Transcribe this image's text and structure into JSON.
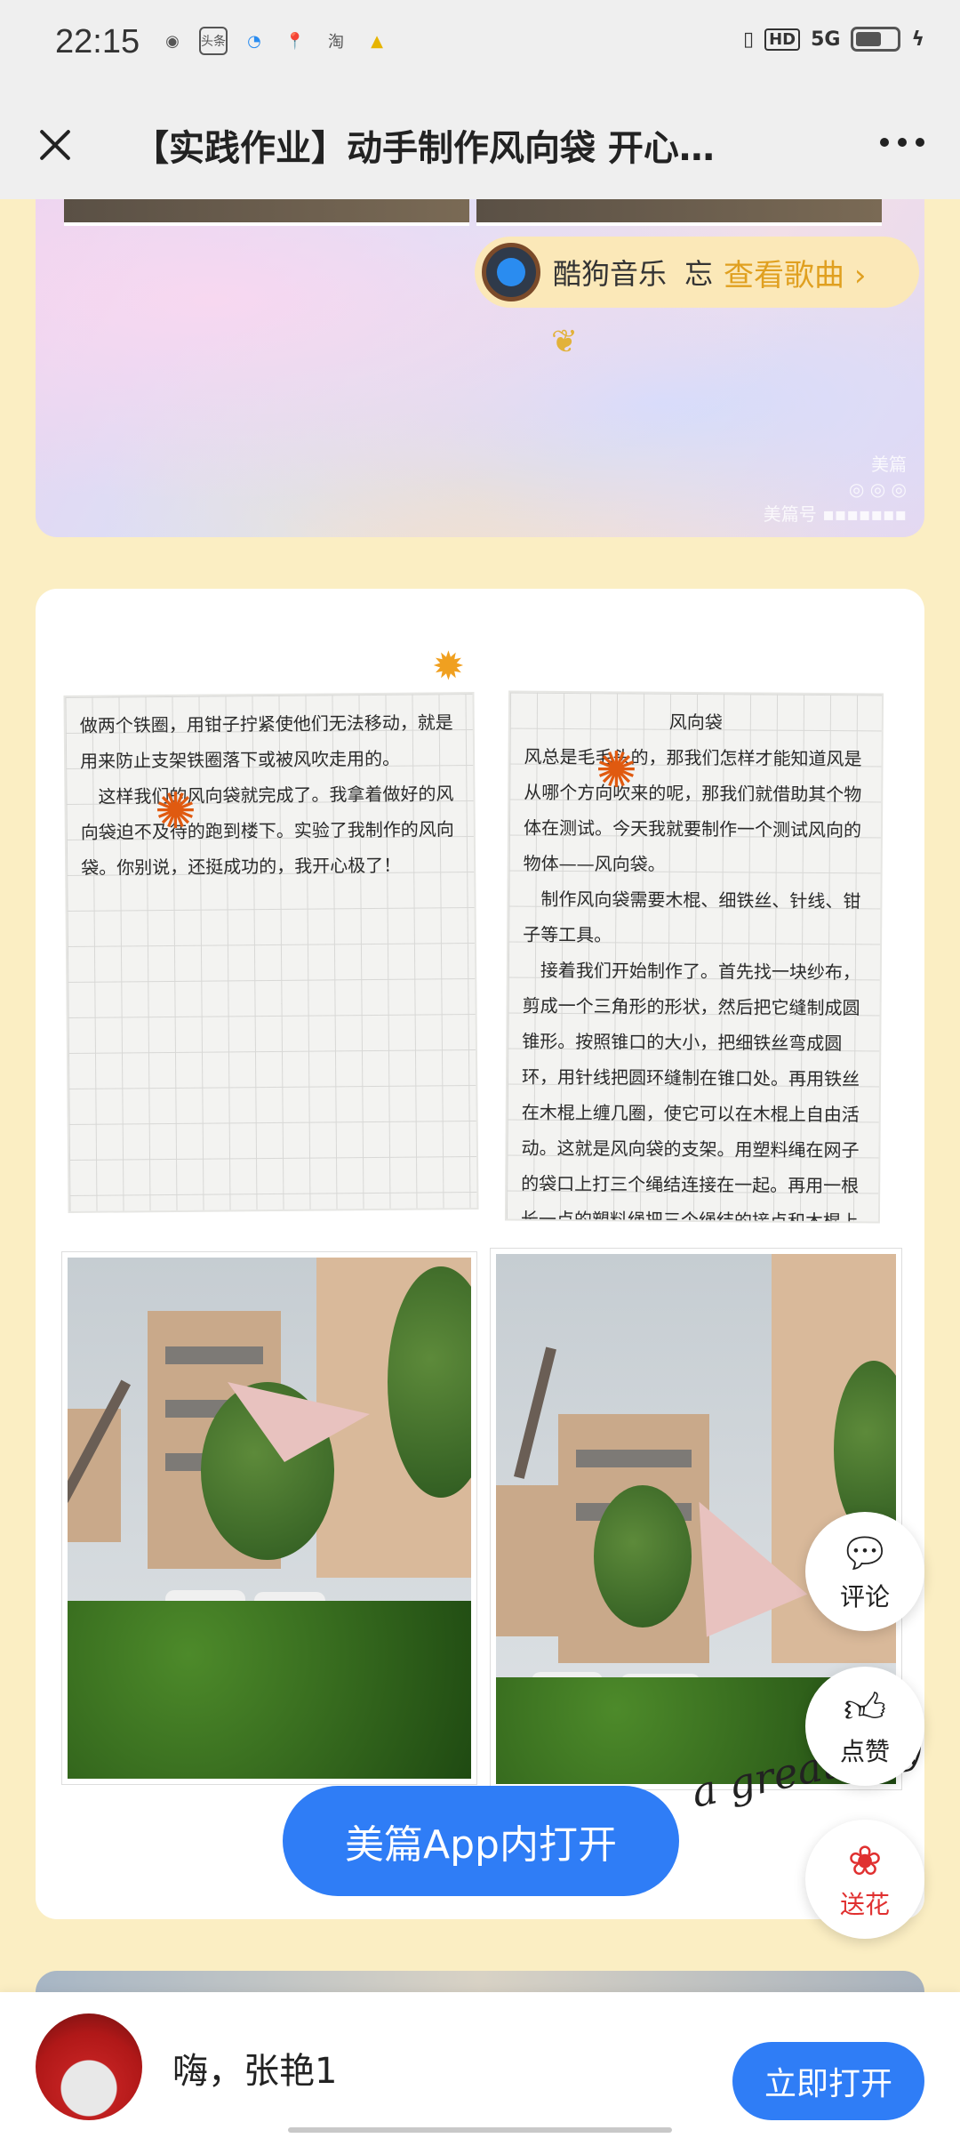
{
  "status_bar": {
    "time": "22:15",
    "apps": [
      "wechat-icon",
      "toutiao-icon",
      "browser-icon",
      "map-icon",
      "taobao-icon",
      "game-icon"
    ],
    "app_glyphs": [
      "◉",
      "头条",
      "◔",
      "📍",
      "淘",
      "▲"
    ],
    "network": "HD",
    "signal": "5G"
  },
  "title_bar": {
    "title": "【实践作业】动手制作风向袋 开心…"
  },
  "music": {
    "app_name": "酷狗音乐",
    "song": "忘",
    "lyrics_button": "查看歌曲 ›"
  },
  "notes": {
    "left_text": "做两个铁圈，用钳子拧紧使他们无法移动，就是用来防止支架铁圈落下或被风吹走用的。\n　这样我们的风向袋就完成了。我拿着做好的风向袋迫不及待的跑到楼下。实验了我制作的风向袋。你别说，还挺成功的，我开心极了！",
    "right_title": "风向袋",
    "right_text": "风总是毛毛头的，那我们怎样才能知道风是从哪个方向吹来的呢，那我们就借助其个物体在测试。今天我就要制作一个测试风向的物体——风向袋。\n　制作风向袋需要木棍、细铁丝、针线、钳子等工具。\n　接着我们开始制作了。首先找一块纱布，剪成一个三角形的形状，然后把它缝制成圆锥形。按照锥口的大小，把细铁丝弯成圆环，用针线把圆环缝制在锥口处。再用铁丝在木棍上缠几圈，使它可以在木棍上自由活动。这就是风向袋的支架。用塑料绳在网子的袋口上打三个绳结连接在一起。再用一根长一点的塑料绳把三个绳结的接点和木棍上的铁丝圈圈绑在一起。在木棍上能转动铁圈的上下两侧再"
  },
  "script_text": "a great day",
  "open_in_app": "美篇App内打开",
  "side_actions": {
    "comment": "评论",
    "like": "点赞",
    "flower": "送花"
  },
  "bottom_bar": {
    "greeting": "嗨，张艳1",
    "open_now": "立即打开"
  },
  "colors": {
    "page_bg": "#fbeec3",
    "accent_blue": "#2f7df6",
    "lyrics_orange": "#e0a020",
    "flower_red": "#e03030"
  }
}
